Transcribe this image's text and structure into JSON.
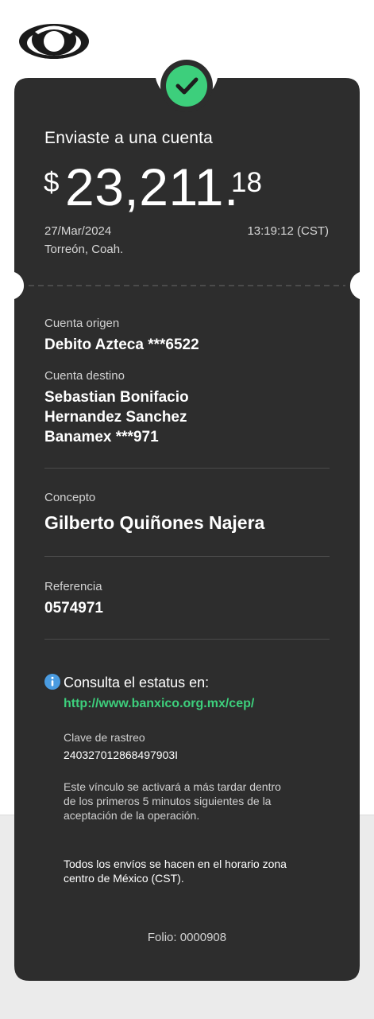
{
  "header": {
    "logo_icon": "bank-logo-icon",
    "check_icon": "check-circle-icon",
    "accent_color": "#3dcf7c"
  },
  "summary": {
    "title": "Enviaste a una cuenta",
    "currency_symbol": "$",
    "amount_main": "23,211.",
    "amount_cents": "18",
    "date": "27/Mar/2024",
    "time": "13:19:12 (CST)",
    "location": "Torreón, Coah."
  },
  "details": {
    "origin_label": "Cuenta origen",
    "origin_value": "Debito Azteca ***6522",
    "destination_label": "Cuenta destino",
    "destination_lines": [
      "Sebastian Bonifacio",
      "Hernandez Sanchez",
      "Banamex ***971"
    ],
    "concept_label": "Concepto",
    "concept_value": "Gilberto Quiñones Najera",
    "reference_label": "Referencia",
    "reference_value": "0574971"
  },
  "status": {
    "info_icon": "info-icon",
    "title": "Consulta el estatus en:",
    "link": "http://www.banxico.org.mx/cep/",
    "tracking_label": "Clave de rastreo",
    "tracking_value": "240327012868497903I",
    "notes": [
      "Este vínculo se activará a más tardar dentro",
      "de los primeros 5 minutos siguientes de la",
      "aceptación de la operación."
    ],
    "schedule_notes": [
      "Todos los envíos se hacen en el horario zona",
      "centro de México (CST)."
    ]
  },
  "footer": {
    "folio": "Folio: 0000908"
  },
  "colors": {
    "card": "#2d2d2d",
    "page": "#ffffff",
    "band": "#ebebeb"
  }
}
